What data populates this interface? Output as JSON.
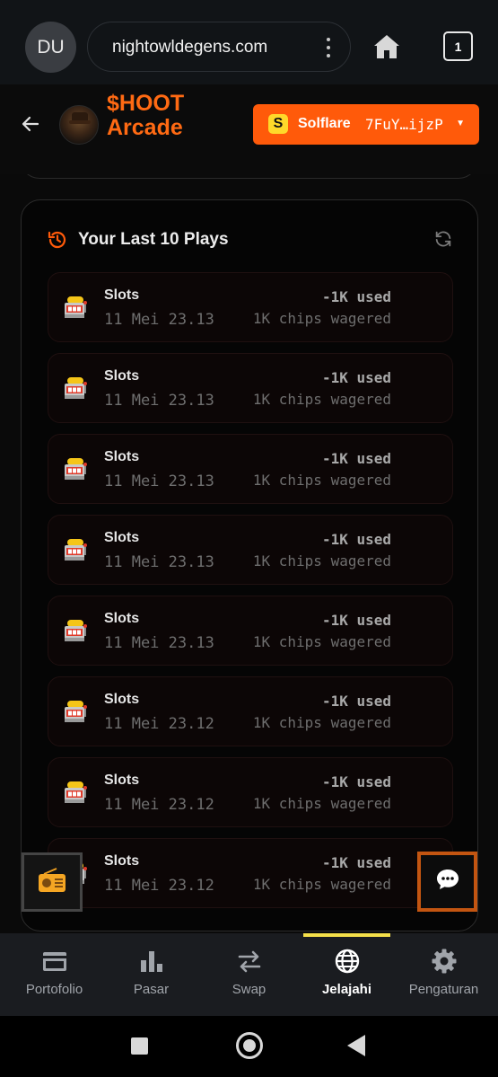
{
  "browser": {
    "avatar_initials": "DU",
    "url": "nightowldegens.com",
    "tab_count": "1"
  },
  "header": {
    "brand_line1": "$HOOT",
    "brand_line2": "Arcade",
    "wallet_name": "Solflare",
    "wallet_address": "7FuY…ijzP",
    "wallet_icon_letter": "S"
  },
  "plays": {
    "title": "Your Last 10 Plays",
    "items": [
      {
        "game": "Slots",
        "date": "11 Mei 23.13",
        "used": "-1K used",
        "wagered": "1K chips wagered"
      },
      {
        "game": "Slots",
        "date": "11 Mei 23.13",
        "used": "-1K used",
        "wagered": "1K chips wagered"
      },
      {
        "game": "Slots",
        "date": "11 Mei 23.13",
        "used": "-1K used",
        "wagered": "1K chips wagered"
      },
      {
        "game": "Slots",
        "date": "11 Mei 23.13",
        "used": "-1K used",
        "wagered": "1K chips wagered"
      },
      {
        "game": "Slots",
        "date": "11 Mei 23.13",
        "used": "-1K used",
        "wagered": "1K chips wagered"
      },
      {
        "game": "Slots",
        "date": "11 Mei 23.12",
        "used": "-1K used",
        "wagered": "1K chips wagered"
      },
      {
        "game": "Slots",
        "date": "11 Mei 23.12",
        "used": "-1K used",
        "wagered": "1K chips wagered"
      },
      {
        "game": "Slots",
        "date": "11 Mei 23.12",
        "used": "-1K used",
        "wagered": "1K chips wagered"
      }
    ]
  },
  "bottom_nav": {
    "items": [
      {
        "label": "Portofolio",
        "icon": "wallet-icon"
      },
      {
        "label": "Pasar",
        "icon": "bar-chart-icon"
      },
      {
        "label": "Swap",
        "icon": "swap-arrows-icon"
      },
      {
        "label": "Jelajahi",
        "icon": "globe-icon",
        "active": true
      },
      {
        "label": "Pengaturan",
        "icon": "gear-icon"
      }
    ]
  },
  "colors": {
    "accent": "#ff5a0a",
    "brand": "#ff6a13",
    "active_indicator": "#f5e04a"
  }
}
